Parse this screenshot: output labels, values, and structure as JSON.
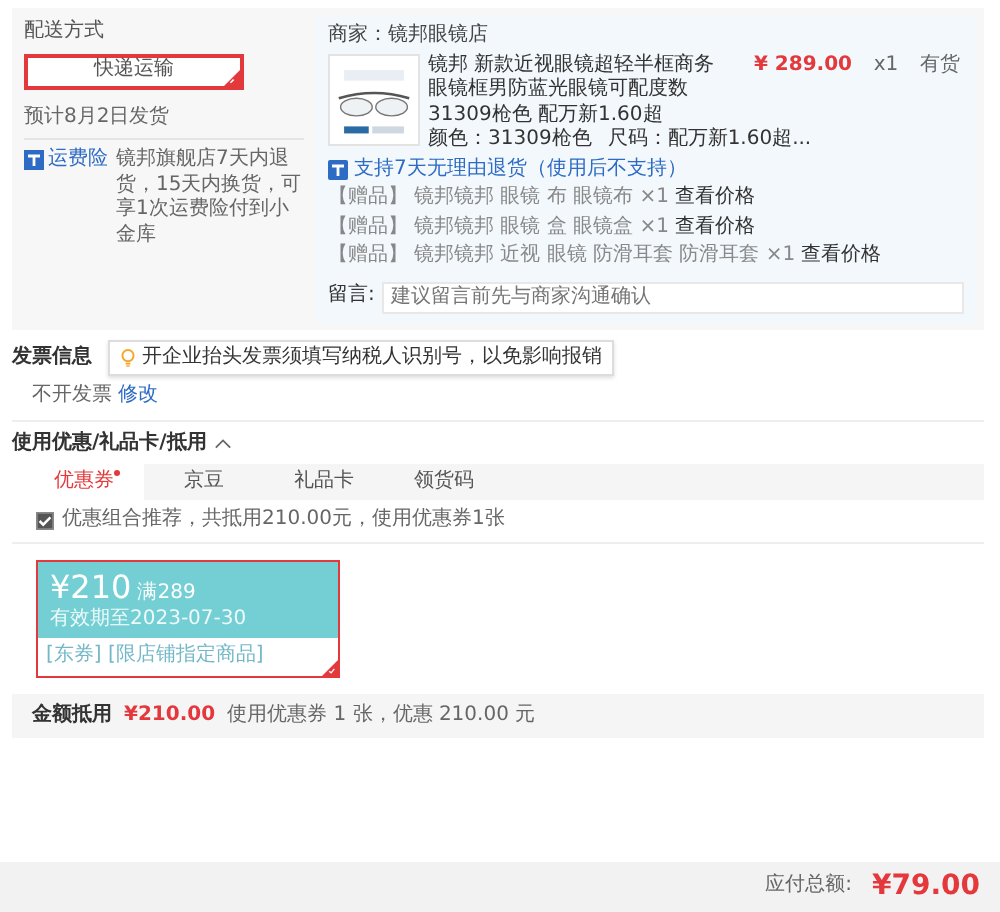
{
  "delivery": {
    "title": "配送方式",
    "option": {
      "label": "快递运输",
      "selected": true
    },
    "estimate": "预计8月2日发货",
    "insurance": {
      "badge": "运费险",
      "text": "镜邦旗舰店7天内退货，15天内换货，可享1次运费险付到小金库"
    }
  },
  "shop": {
    "label": "商家：",
    "name": "镜邦眼镜店"
  },
  "product": {
    "title": "镜邦 新款近视眼镜超轻半框商务眼镜框男防蓝光眼镜可配度数 31309枪色 配万新1.60超",
    "price": "¥ 289.00",
    "quantity": "x1",
    "stock": "有货",
    "color": {
      "label": "颜色：",
      "value": "31309枪色"
    },
    "size": {
      "label": "尺码：",
      "value": "配万新1.60超..."
    },
    "return_policy": "支持7天无理由退货（使用后不支持）"
  },
  "gifts": [
    {
      "tag": "【赠品】",
      "name": "镜邦镜邦 眼镜 布 眼镜布 ×1",
      "link": "查看价格"
    },
    {
      "tag": "【赠品】",
      "name": "镜邦镜邦 眼镜 盒 眼镜盒 ×1",
      "link": "查看价格"
    },
    {
      "tag": "【赠品】",
      "name": "镜邦镜邦 近视 眼镜 防滑耳套 防滑耳套 ×1",
      "link": "查看价格"
    }
  ],
  "message": {
    "label": "留言:",
    "placeholder": "建议留言前先与商家沟通确认"
  },
  "invoice": {
    "title": "发票信息",
    "tip": "开企业抬头发票须填写纳税人识别号，以免影响报销",
    "value": "不开发票",
    "edit_link": "修改"
  },
  "discount": {
    "title": "使用优惠/礼品卡/抵用",
    "expanded": true,
    "tabs": [
      {
        "label": "优惠券",
        "selected": true,
        "dot": true
      },
      {
        "label": "京豆",
        "selected": false,
        "dot": false
      },
      {
        "label": "礼品卡",
        "selected": false,
        "dot": false
      },
      {
        "label": "领货码",
        "selected": false,
        "dot": false
      }
    ],
    "recommend": {
      "checked": true,
      "text": "优惠组合推荐，共抵用210.00元，使用优惠券1张"
    },
    "coupons": [
      {
        "amount": "¥210",
        "condition": "满289",
        "validity": "有效期至2023-07-30",
        "tags": "[东券] [限店铺指定商品]",
        "selected": true
      }
    ],
    "summary": {
      "label": "金额抵用",
      "amount": "¥210.00",
      "detail": "使用优惠券 1 张，优惠 210.00 元"
    }
  },
  "total": {
    "label": "应付总额:",
    "amount": "¥79.00"
  }
}
